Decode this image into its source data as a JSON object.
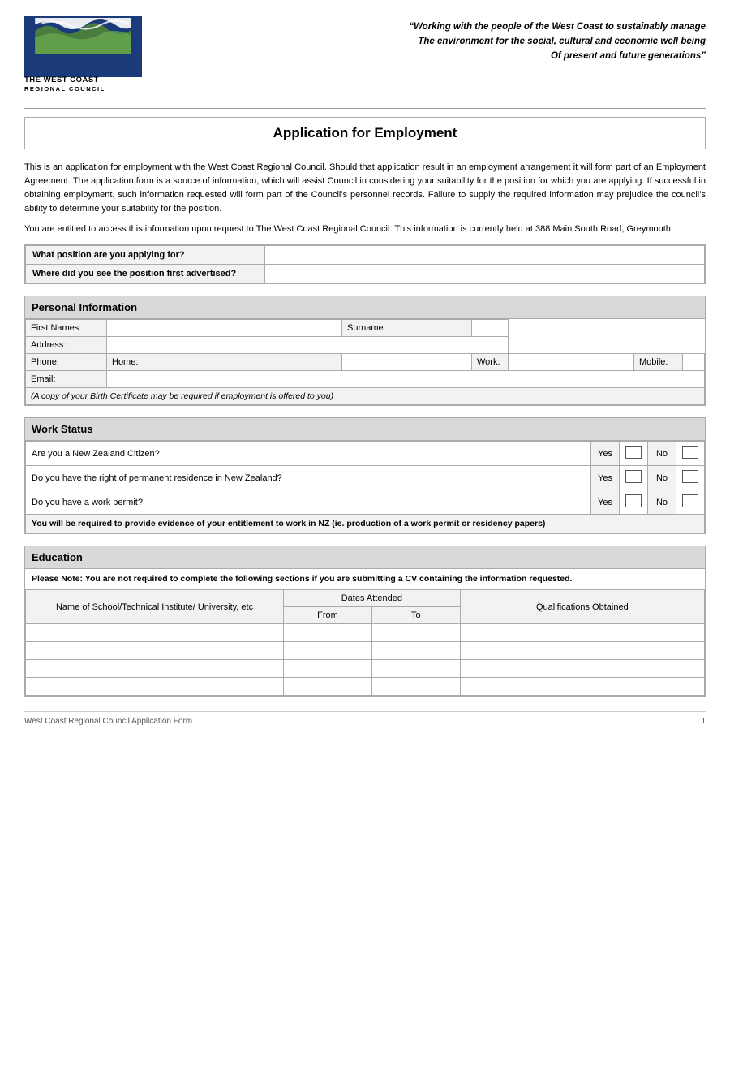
{
  "header": {
    "tagline_line1": "“Working with the people of the West Coast to sustainably manage",
    "tagline_line2": "The environment for the social, cultural and economic well being",
    "tagline_line3": "Of present and future generations”",
    "logo_line1": "THE WEST COAST",
    "logo_line2": "REGIONAL COUNCIL"
  },
  "title": "Application for Employment",
  "intro": {
    "para1": "This is an application for employment with the West Coast Regional Council.  Should that application result in an employment arrangement it will form part of an Employment Agreement.  The application form is a source of information, which will assist Council in considering your suitability for the position for which you are applying.  If successful in obtaining employment, such information requested will form part of the Council’s personnel records.  Failure to supply the required information may prejudice the council’s ability to determine your suitability for the position.",
    "para2": "You are entitled to access this information upon request to The West Coast Regional Council.  This information is currently held at 388 Main South Road, Greymouth."
  },
  "position_section": {
    "q1_label": "What position are you applying for?",
    "q2_label": "Where did you see the position first advertised?"
  },
  "personal_info": {
    "section_header": "Personal Information",
    "first_names_label": "First Names",
    "surname_label": "Surname",
    "address_label": "Address:",
    "phone_label": "Phone:",
    "home_label": "Home:",
    "work_label": "Work:",
    "mobile_label": "Mobile:",
    "email_label": "Email:",
    "note": "(A copy of your Birth Certificate may be required if employment is offered to you)"
  },
  "work_status": {
    "section_header": "Work Status",
    "q1": "Are you a New Zealand Citizen?",
    "q2": "Do you have the right of permanent residence in New Zealand?",
    "q3": "Do you have a work permit?",
    "yes_label": "Yes",
    "no_label": "No",
    "note": "You will be required to provide evidence of your entitlement to work in NZ (ie. production of a work permit or residency papers)"
  },
  "education": {
    "section_header": "Education",
    "note": "Please Note: You are not required to complete the following sections if you are submitting a CV containing the information requested.",
    "col_name": "Name of School/Technical Institute/ University, etc",
    "col_dates": "Dates Attended",
    "col_from": "From",
    "col_to": "To",
    "col_qual": "Qualifications Obtained",
    "rows": [
      {
        "name": "",
        "from": "",
        "to": "",
        "qual": ""
      },
      {
        "name": "",
        "from": "",
        "to": "",
        "qual": ""
      },
      {
        "name": "",
        "from": "",
        "to": "",
        "qual": ""
      },
      {
        "name": "",
        "from": "",
        "to": "",
        "qual": ""
      }
    ]
  },
  "footer": {
    "left": "West Coast Regional Council Application Form",
    "right": "1"
  }
}
